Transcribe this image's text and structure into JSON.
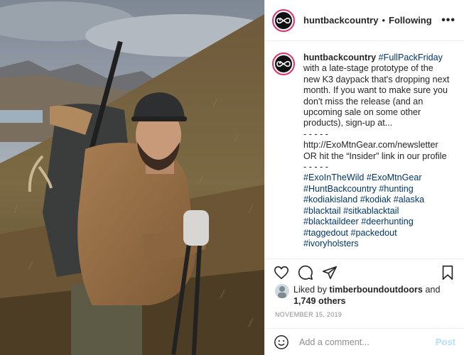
{
  "post": {
    "username": "huntbackcountry",
    "dot": "•",
    "following": "Following",
    "more": "•••"
  },
  "caption": {
    "username": "huntbackcountry",
    "lines": [
      "#FullPackFriday",
      "with a late-stage prototype of the",
      "new K3 daypack that's dropping next",
      "month. If you want to make sure you",
      "don't miss the release (and an",
      "upcoming sale on some other",
      "products), sign-up at...",
      "- - - - -",
      "http://ExoMtnGear.com/newsletter",
      "OR hit the “Insider” link in our profile",
      "- - - - -",
      "#ExoInTheWild #ExoMtnGear",
      "#HuntBackcountry #hunting",
      "#kodiakisland #kodiak #alaska",
      "#blacktail #sitkablacktail",
      "#blacktaildeer #deerhunting",
      "#taggedout #packedout",
      "#ivoryholsters"
    ]
  },
  "likes": {
    "prefix": "Liked by",
    "user": "timberboundoutdoors",
    "and": "and",
    "count": "1,749 others"
  },
  "date": "NOVEMBER 15, 2019",
  "comment": {
    "placeholder": "Add a comment...",
    "post_label": "Post"
  },
  "icons": [
    "heart-icon",
    "comment-icon",
    "share-icon",
    "bookmark-icon",
    "emoji-icon",
    "infinity-logo"
  ],
  "colors": {
    "link": "#00376b",
    "ring": "#e1306c",
    "post_disabled": "#b2dffc"
  }
}
